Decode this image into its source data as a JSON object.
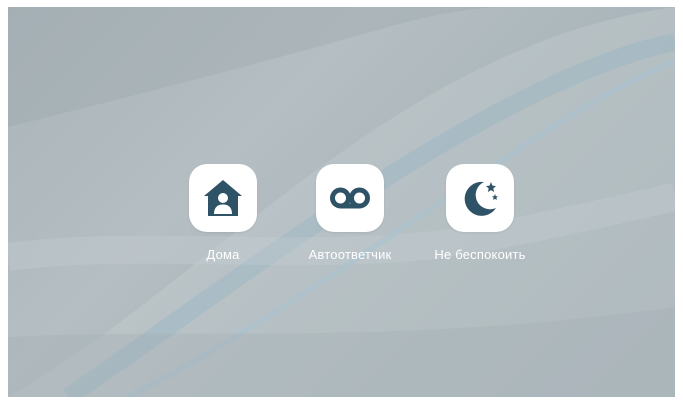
{
  "modes": [
    {
      "id": "home",
      "label": "Дома",
      "icon": "home-person-icon"
    },
    {
      "id": "answering",
      "label": "Автоответчик",
      "icon": "voicemail-icon"
    },
    {
      "id": "dnd",
      "label": "Не беспокоить",
      "icon": "moon-stars-icon"
    }
  ],
  "colors": {
    "background": "#aeb8bd",
    "tile": "#ffffff",
    "icon": "#2f5366",
    "label": "#ffffff"
  }
}
